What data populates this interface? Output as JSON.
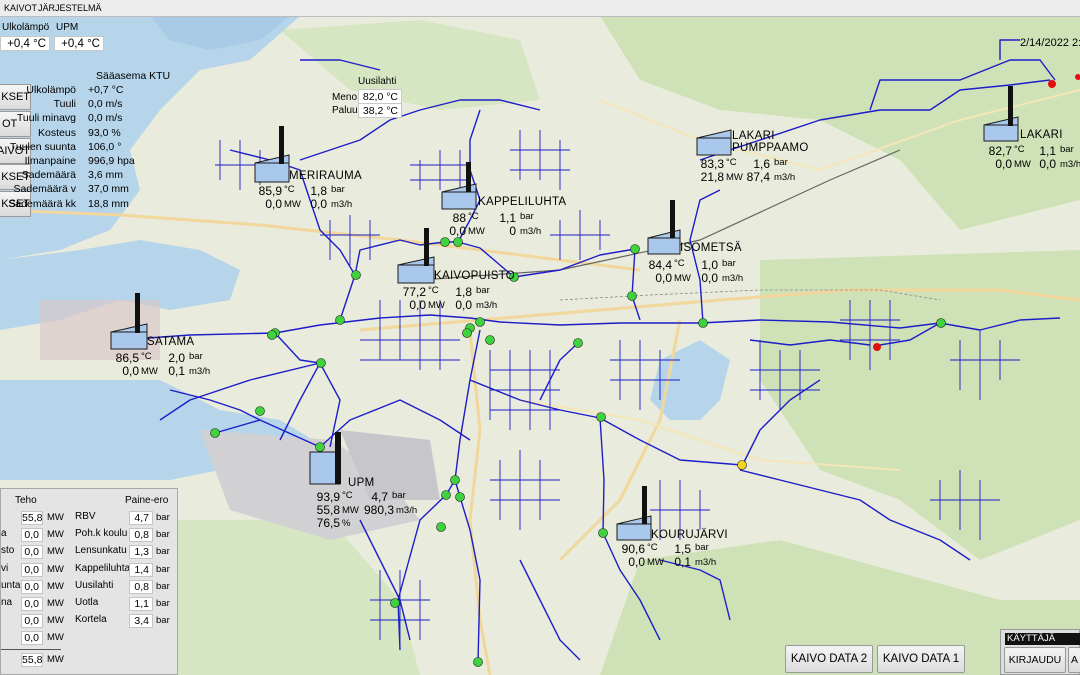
{
  "menu": {
    "items": [
      "KAIVOT",
      "JÄRJESTELMÄ"
    ]
  },
  "datetime": "2/14/2022 2:",
  "outdoor": {
    "ulkolampo_label": "Ulkolämpö",
    "ulkolampo_value": "+0,4 °C",
    "upm_label": "UPM",
    "upm_value": "+0,4 °C"
  },
  "side_buttons": [
    "KSET",
    "OT",
    "KAIVOT",
    "KSET",
    "KSET"
  ],
  "weather": {
    "title": "Sääasema KTU",
    "rows": [
      {
        "label": "Ulkolämpö",
        "value": "+0,7 °C"
      },
      {
        "label": "Tuuli",
        "value": "0,0 m/s"
      },
      {
        "label": "Tuuli minavg",
        "value": "0,0 m/s"
      },
      {
        "label": "Kosteus",
        "value": "93,0 %"
      },
      {
        "label": "Tuulen suunta",
        "value": "106,0 °"
      },
      {
        "label": "Ilmanpaine",
        "value": "996,9 hpa"
      },
      {
        "label": "Sademäärä",
        "value": "3,6 mm"
      },
      {
        "label": "Sademäärä v",
        "value": "37,0 mm"
      },
      {
        "label": "Sademäärä kk",
        "value": "18,8 mm"
      }
    ]
  },
  "uusilahti": {
    "title": "Uusilahti",
    "meno_label": "Meno",
    "meno_value": "82,0 °C",
    "paluu_label": "Paluu",
    "paluu_value": "38,2 °C"
  },
  "stations": {
    "merirauma": {
      "name": "MERIRAUMA",
      "temp": "85,9",
      "bar": "1,8",
      "mw": "0,0",
      "flow": "0,0"
    },
    "kappeliluhta": {
      "name": "KAPPELILUHTA",
      "temp": "88",
      "bar": "1,1",
      "mw": "0,0",
      "flow": "0"
    },
    "kaivopuisto": {
      "name": "KAIVOPUISTO",
      "temp": "77,2",
      "bar": "1,8",
      "mw": "0,0",
      "flow": "0,0"
    },
    "satama": {
      "name": "SATAMA",
      "temp": "86,5",
      "bar": "2,0",
      "mw": "0,0",
      "flow": "0,1"
    },
    "lakari_pump": {
      "name1": "LAKARI",
      "name2": "PUMPPAAMO",
      "temp": "83,3",
      "bar": "1,6",
      "mw": "21,8",
      "flow": "87,4"
    },
    "isometsa": {
      "name": "ISOMETSÄ",
      "temp": "84,4",
      "bar": "1,0",
      "mw": "0,0",
      "flow": "0,0"
    },
    "lakari": {
      "name": "LAKARI",
      "temp": "82,7",
      "bar": "1,1",
      "mw": "0,0",
      "flow": "0,0"
    },
    "upm": {
      "name": "UPM",
      "temp": "93,9",
      "bar": "4,7",
      "mw": "55,8",
      "flow": "980,3",
      "pct": "76,5"
    },
    "kourujarvi": {
      "name": "KOURUJÄRVI",
      "temp": "90,6",
      "bar": "1,5",
      "mw": "0,0",
      "flow": "0,1"
    }
  },
  "units": {
    "c": "°C",
    "bar": "bar",
    "mw": "MW",
    "m3h": "m3/h",
    "pct": "%"
  },
  "panel": {
    "teho_header": "Teho",
    "paine_header": "Paine-ero",
    "teho_rows": [
      {
        "label": "",
        "value": "55,8"
      },
      {
        "label": "a",
        "value": "0,0"
      },
      {
        "label": "sto",
        "value": "0,0"
      },
      {
        "label": "vi",
        "value": "0,0"
      },
      {
        "label": "unta",
        "value": "0,0"
      },
      {
        "label": "na",
        "value": "0,0"
      },
      {
        "label": "",
        "value": "0,0"
      },
      {
        "label": "",
        "value": "0,0"
      },
      {
        "label": "",
        "value": "55,8"
      }
    ],
    "paine_rows": [
      {
        "label": "RBV",
        "value": "4,7"
      },
      {
        "label": "Poh.k koulu",
        "value": "0,8"
      },
      {
        "label": "Lensunkatu",
        "value": "1,3"
      },
      {
        "label": "Kappeliluhta",
        "value": "1,4"
      },
      {
        "label": "Uusilahti",
        "value": "0,8"
      },
      {
        "label": "Uotla",
        "value": "1,1"
      },
      {
        "label": "Kortela",
        "value": "3,4"
      }
    ]
  },
  "buttons": {
    "kaivo2": "KAIVO DATA 2",
    "kaivo1": "KAIVO DATA 1",
    "kayttaja": "KÄYTTÄJÄ",
    "kirjaudu": "KIRJAUDU",
    "a": "A"
  },
  "colors": {
    "pipe": "#1d1dc8",
    "node": "#3ed23e",
    "alarm": "#e01010",
    "station": "#a9c8ec",
    "water": "#b3d3ec",
    "land": "#e8eddc",
    "forest": "#c9deb0"
  }
}
